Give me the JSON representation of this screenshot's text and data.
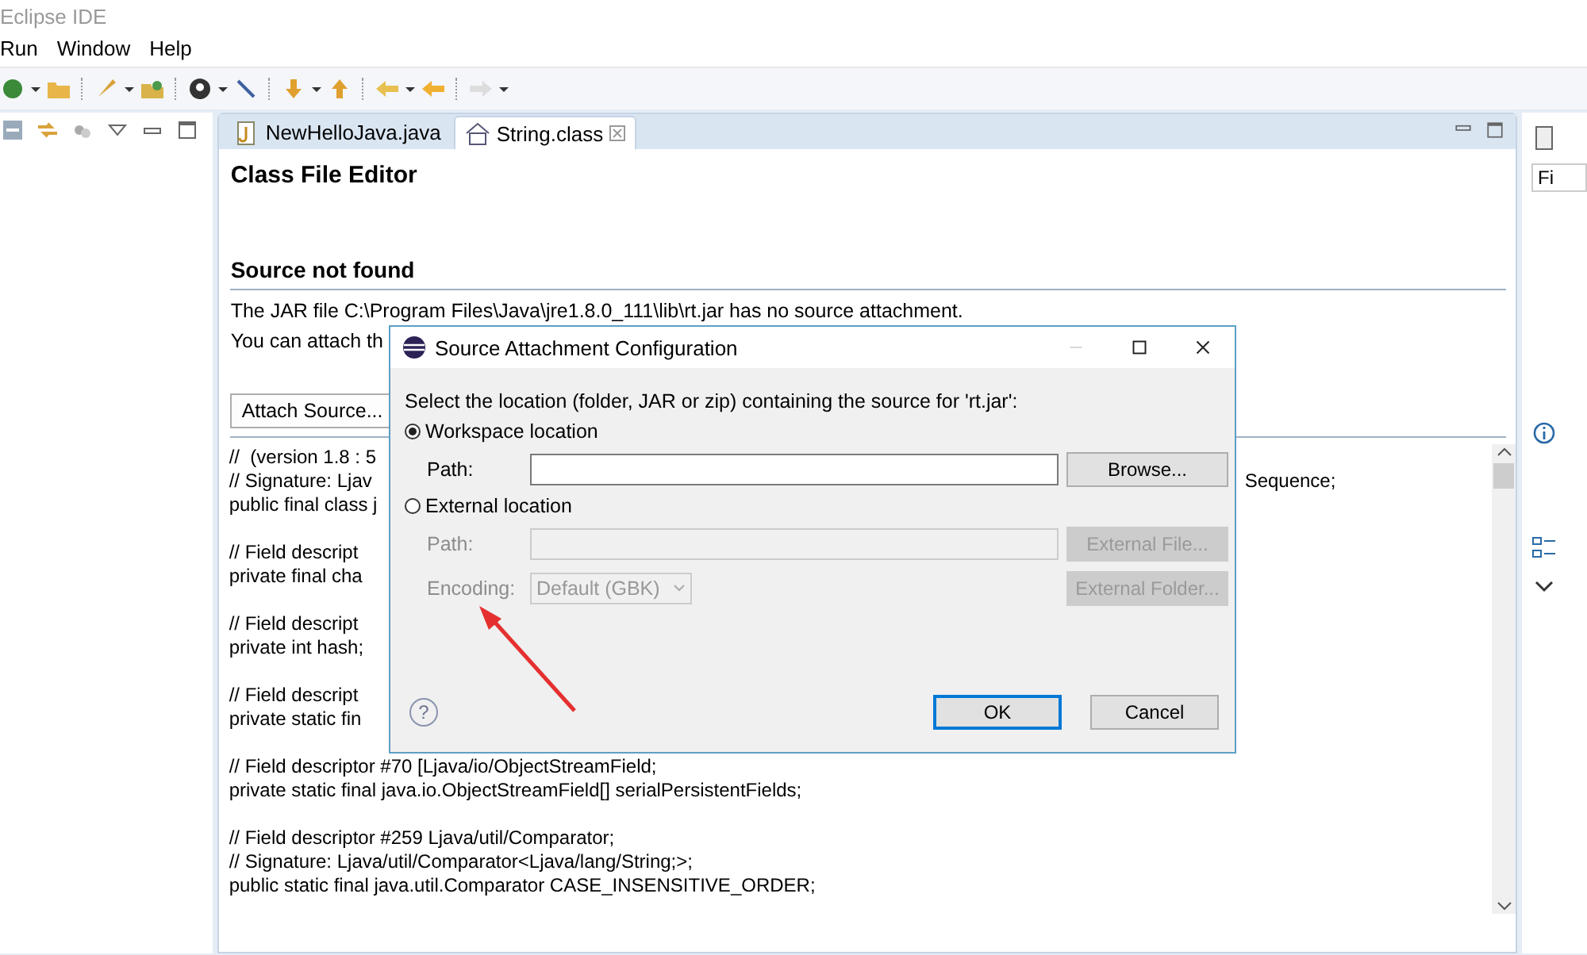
{
  "window": {
    "title": "Eclipse IDE"
  },
  "menu": [
    "Run",
    "Window",
    "Help"
  ],
  "editor": {
    "tabs": [
      {
        "label": "NewHelloJava.java",
        "selected": false,
        "closable": false
      },
      {
        "label": "String.class",
        "selected": true,
        "closable": true
      }
    ],
    "heading": "Class File Editor",
    "section": "Source not found",
    "messages": [
      "The JAR file C:\\Program Files\\Java\\jre1.8.0_111\\lib\\rt.jar has no source attachment.",
      "You can attach th"
    ],
    "attach_button": "Attach Source...",
    "code_blocks": [
      {
        "lines": [
          {
            "text": "//  (version 1.8 : 5"
          },
          {
            "text": "// Signature: Ljav",
            "tail": "Sequence;"
          },
          {
            "text": "public final class j"
          }
        ]
      },
      {
        "lines": [
          {
            "text": "// Field descript"
          },
          {
            "text": "private final cha"
          }
        ]
      },
      {
        "lines": [
          {
            "text": "// Field descript"
          },
          {
            "text": "private int hash;"
          }
        ]
      },
      {
        "lines": [
          {
            "text": "// Field descript"
          },
          {
            "text": "private static fin"
          }
        ]
      },
      {
        "lines": [
          {
            "text": "// Field descriptor #70 [Ljava/io/ObjectStreamField;"
          },
          {
            "text": "private static final java.io.ObjectStreamField[] serialPersistentFields;"
          }
        ]
      },
      {
        "lines": [
          {
            "text": "// Field descriptor #259 Ljava/util/Comparator;"
          },
          {
            "text": "// Signature: Ljava/util/Comparator<Ljava/lang/String;>;"
          },
          {
            "text": "public static final java.util.Comparator CASE_INSENSITIVE_ORDER;"
          }
        ]
      }
    ]
  },
  "right_panel": {
    "field_value": "Fi"
  },
  "dialog": {
    "title": "Source Attachment Configuration",
    "prompt": "Select the location (folder, JAR or zip) containing the source for 'rt.jar':",
    "options": [
      {
        "label": "Workspace location",
        "selected": true,
        "rows": [
          {
            "label": "Path:",
            "kind": "field",
            "disabled": false,
            "button": "Browse..."
          }
        ]
      },
      {
        "label": "External location",
        "selected": false,
        "rows": [
          {
            "label": "Path:",
            "kind": "field",
            "disabled": true,
            "button": "External File..."
          },
          {
            "label": "Encoding:",
            "kind": "select",
            "disabled": true,
            "value": "Default (GBK)",
            "button": "External Folder..."
          }
        ]
      }
    ],
    "help": "?",
    "buttons": [
      {
        "label": "OK",
        "default": true
      },
      {
        "label": "Cancel",
        "default": false
      }
    ]
  }
}
